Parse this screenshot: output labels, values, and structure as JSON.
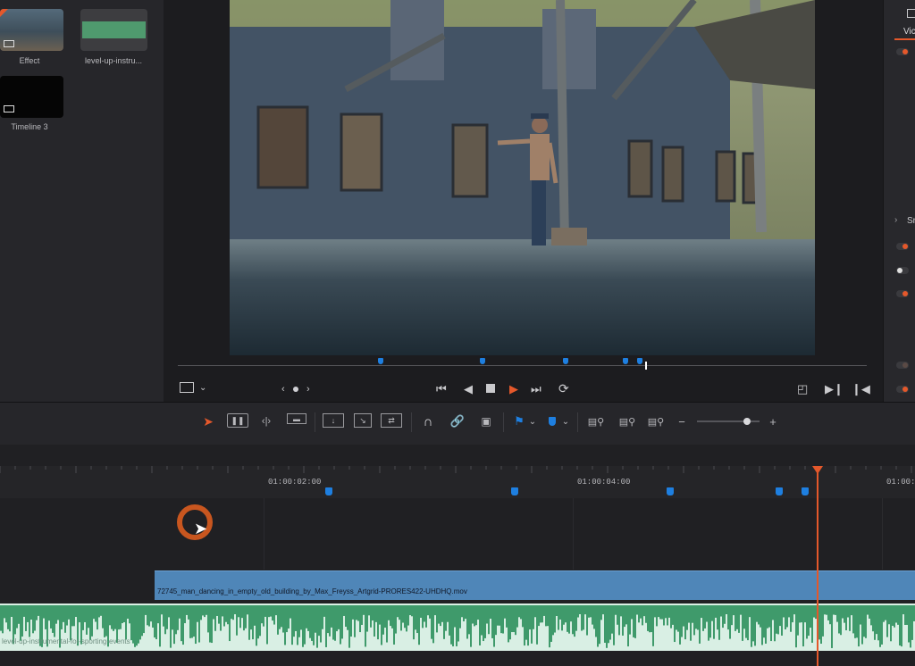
{
  "media_pool": {
    "items": [
      {
        "label": "Effect"
      },
      {
        "label": "level-up-instru..."
      },
      {
        "label": "Timeline 3"
      }
    ]
  },
  "inspector": {
    "tab_label": "Vic",
    "section_label": "Sr"
  },
  "ruler": {
    "timecodes": [
      "01:00:02:00",
      "01:00:04:00",
      "01:00:0"
    ]
  },
  "timeline": {
    "video_clip_name": "72745_man_dancing_in_empty_old_building_by_Max_Freyss_Artgrid-PRORES422-UHDHQ.mov",
    "audio_clip_name": "level-up-instrumental-for-sporting-events"
  },
  "colors": {
    "accent": "#e4582b",
    "marker": "#1e7fe0",
    "video_clip": "#4f86b8",
    "audio_clip": "#d9efe4",
    "waveform": "#3f9a6b"
  },
  "icons": [
    "selection-arrow-icon",
    "trim-icon",
    "dynamic-trim-icon",
    "blade-icon",
    "insert-icon",
    "overwrite-icon",
    "replace-icon",
    "snapping-icon",
    "link-icon",
    "lock-icon",
    "flag-icon",
    "marker-icon",
    "zoom-full-icon",
    "zoom-detail-icon",
    "zoom-custom-icon"
  ]
}
